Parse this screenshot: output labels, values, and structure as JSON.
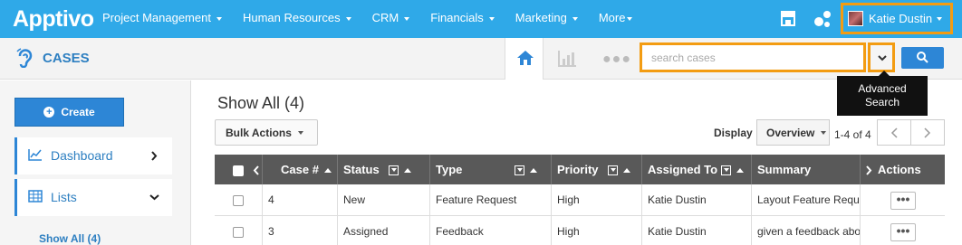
{
  "topnav": {
    "logo": "Apptivo",
    "menu": [
      {
        "label": "Project Management"
      },
      {
        "label": "Human Resources"
      },
      {
        "label": "CRM"
      },
      {
        "label": "Financials"
      },
      {
        "label": "Marketing"
      },
      {
        "label": "More"
      }
    ],
    "user_name": "Katie Dustin",
    "accent_color": "#2fa9e8",
    "highlight_color": "#f39c12"
  },
  "subbar": {
    "app_title": "CASES",
    "search_placeholder": "search cases"
  },
  "tooltip": {
    "line1": "Advanced",
    "line2": "Search"
  },
  "sidebar": {
    "create_label": "Create",
    "items": [
      {
        "label": "Dashboard"
      },
      {
        "label": "Lists"
      }
    ],
    "sub_item": "Show All (4)"
  },
  "main": {
    "title": "Show All (4)",
    "bulk_actions": "Bulk Actions",
    "display_label": "Display",
    "display_value": "Overview",
    "page_info": "1-4 of 4"
  },
  "table": {
    "headers": {
      "case_no": "Case #",
      "status": "Status",
      "type": "Type",
      "priority": "Priority",
      "assigned_to": "Assigned To",
      "summary": "Summary",
      "actions": "Actions"
    },
    "rows": [
      {
        "case_no": "4",
        "status": "New",
        "type": "Feature Request",
        "priority": "High",
        "assigned_to": "Katie Dustin",
        "summary": "Layout Feature Requ"
      },
      {
        "case_no": "3",
        "status": "Assigned",
        "type": "Feedback",
        "priority": "High",
        "assigned_to": "Katie Dustin",
        "summary": "given a feedback abo"
      }
    ]
  }
}
